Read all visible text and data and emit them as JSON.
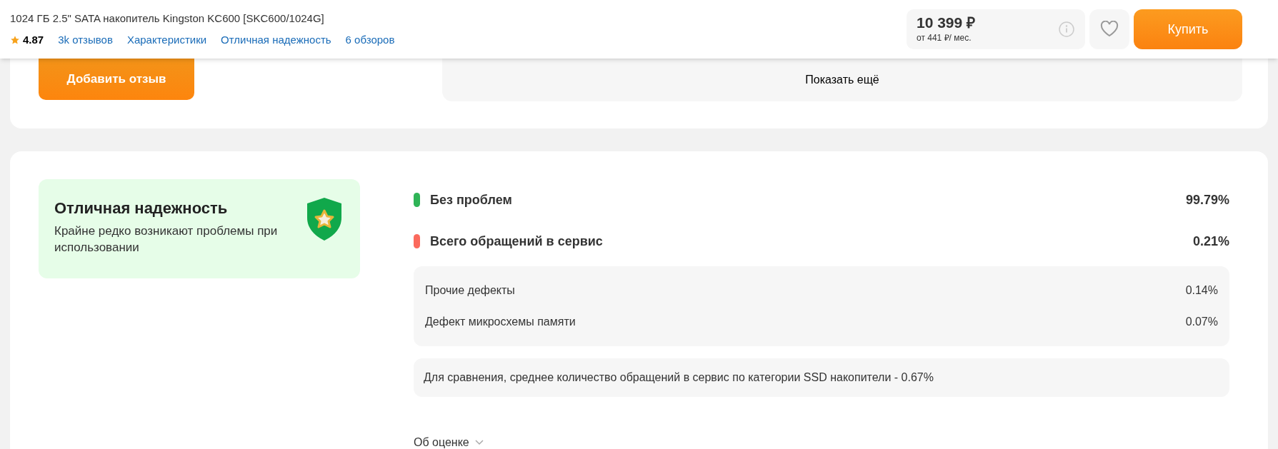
{
  "header": {
    "title": "1024 ГБ 2.5\" SATA накопитель Kingston KC600 [SKC600/1024G]",
    "rating": "4.87",
    "links": [
      "3k отзывов",
      "Характеристики",
      "Отличная надежность",
      "6 обзоров"
    ],
    "price": "10 399 ₽",
    "installment": "от 441 ₽/ мес.",
    "buy": "Купить"
  },
  "reviews": {
    "add_button": "Добавить отзыв",
    "more_button": "Показать ещё"
  },
  "reliability": {
    "title": "Отличная надежность",
    "description": "Крайне редко возникают проблемы при использовании",
    "stats": [
      {
        "label": "Без проблем",
        "value": "99.79%",
        "color": "#2fb457"
      },
      {
        "label": "Всего обращений в сервис",
        "value": "0.21%",
        "color": "#fb6a5d"
      }
    ],
    "defects": [
      {
        "label": "Прочие дефекты",
        "value": "0.14%"
      },
      {
        "label": "Дефект микросхемы памяти",
        "value": "0.07%"
      }
    ],
    "comparison": "Для сравнения, среднее количество обращений в сервис по категории SSD накопители - 0.67%",
    "about": "Об оценке"
  }
}
